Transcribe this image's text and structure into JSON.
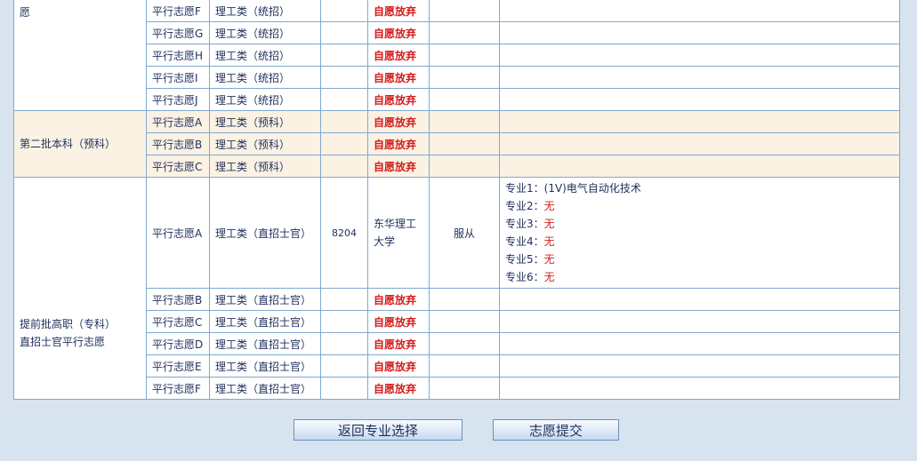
{
  "rows": {
    "top": {
      "batch": "愿"
    },
    "f": {
      "vol": "平行志愿F",
      "type": "理工类（统招）",
      "status": "自愿放弃"
    },
    "g": {
      "vol": "平行志愿G",
      "type": "理工类（统招）",
      "status": "自愿放弃"
    },
    "h": {
      "vol": "平行志愿H",
      "type": "理工类（统招）",
      "status": "自愿放弃"
    },
    "i": {
      "vol": "平行志愿I",
      "type": "理工类（统招）",
      "status": "自愿放弃"
    },
    "j": {
      "vol": "平行志愿J",
      "type": "理工类（统招）",
      "status": "自愿放弃"
    }
  },
  "prep": {
    "batch": "第二批本科（预科）",
    "a": {
      "vol": "平行志愿A",
      "type": "理工类（预科）",
      "status": "自愿放弃"
    },
    "b": {
      "vol": "平行志愿B",
      "type": "理工类（预科）",
      "status": "自愿放弃"
    },
    "c": {
      "vol": "平行志愿C",
      "type": "理工类（预科）",
      "status": "自愿放弃"
    }
  },
  "sergeant": {
    "batch_line1": "提前批高职（专科）",
    "batch_line2": "直招士官平行志愿",
    "a": {
      "vol": "平行志愿A",
      "type": "理工类（直招士官）",
      "code": "8204",
      "school": "东华理工大学",
      "accept": "服从",
      "majors": [
        {
          "label": "专业1：",
          "value": "(1V)电气自动化技术"
        },
        {
          "label": "专业2：",
          "value": "无"
        },
        {
          "label": "专业3：",
          "value": "无"
        },
        {
          "label": "专业4：",
          "value": "无"
        },
        {
          "label": "专业5：",
          "value": "无"
        },
        {
          "label": "专业6：",
          "value": "无"
        }
      ]
    },
    "b": {
      "vol": "平行志愿B",
      "type": "理工类（直招士官）",
      "status": "自愿放弃"
    },
    "c": {
      "vol": "平行志愿C",
      "type": "理工类（直招士官）",
      "status": "自愿放弃"
    },
    "d": {
      "vol": "平行志愿D",
      "type": "理工类（直招士官）",
      "status": "自愿放弃"
    },
    "e": {
      "vol": "平行志愿E",
      "type": "理工类（直招士官）",
      "status": "自愿放弃"
    },
    "f": {
      "vol": "平行志愿F",
      "type": "理工类（直招士官）",
      "status": "自愿放弃"
    }
  },
  "buttons": {
    "back": "返回专业选择",
    "submit": "志愿提交"
  },
  "colors": {
    "page_bg": "#d7e3ef",
    "border": "#7fa9cf",
    "prep_row_bg": "#fbf2e4",
    "give_up_red": "#d41d1d"
  }
}
